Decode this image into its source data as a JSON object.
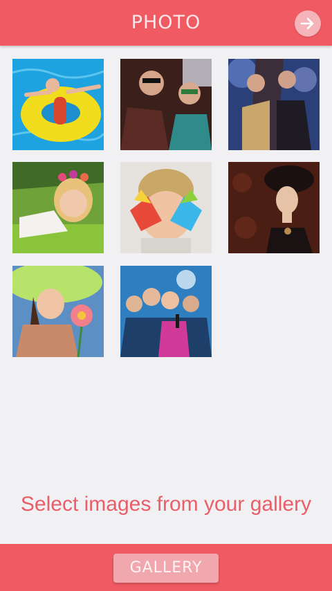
{
  "header": {
    "title": "PHOTO",
    "next_icon": "arrow-right-icon"
  },
  "images": [
    {
      "name": "photo-pool-float",
      "subject": "pool float",
      "accent": "#1ea3e0"
    },
    {
      "name": "photo-friends-sunglasses",
      "subject": "friends with sunglasses",
      "accent": "#3a1f1a"
    },
    {
      "name": "photo-club-party",
      "subject": "club party",
      "accent": "#2b3f78"
    },
    {
      "name": "photo-flower-wreath",
      "subject": "flower wreath",
      "accent": "#6fa33a"
    },
    {
      "name": "photo-painted-hands",
      "subject": "painted hands",
      "accent": "#e6e3df"
    },
    {
      "name": "photo-vintage-portrait",
      "subject": "vintage portrait",
      "accent": "#4b1e14"
    },
    {
      "name": "photo-green-hat",
      "subject": "green hat",
      "accent": "#5c8fc4"
    },
    {
      "name": "photo-karaoke-party",
      "subject": "karaoke party",
      "accent": "#2f7fc0"
    }
  ],
  "hint": {
    "text": "Select images from your gallery"
  },
  "footer": {
    "gallery_label": "GALLERY"
  },
  "colors": {
    "primary": "#ef5a63",
    "background": "#f1f1f3",
    "hint_text": "#e95e68",
    "button": "#f0a7ae"
  }
}
